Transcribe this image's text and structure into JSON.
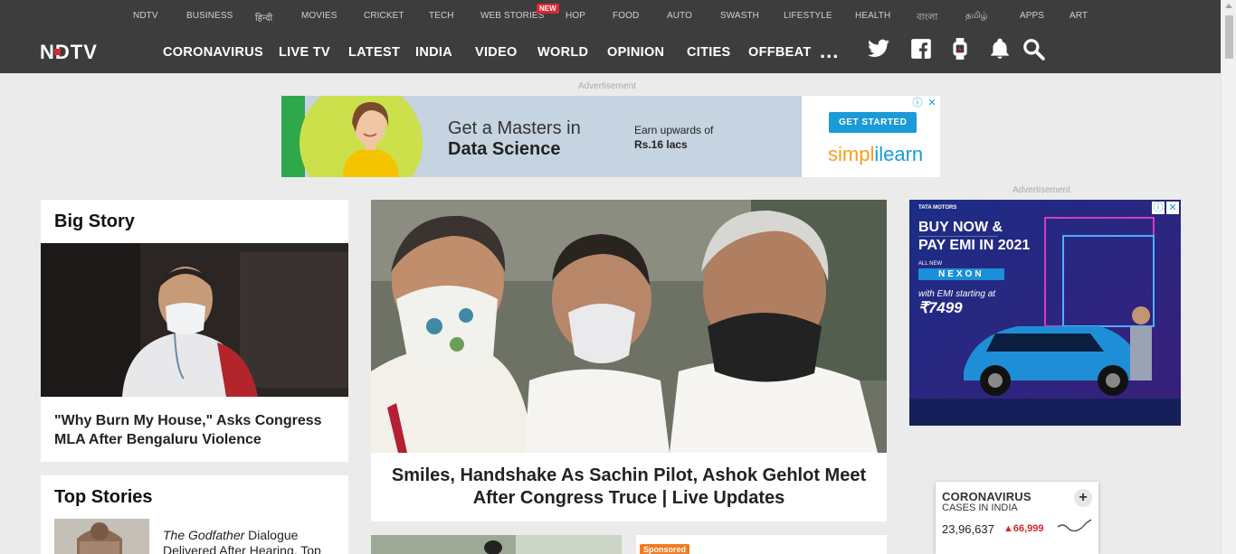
{
  "subnav": [
    "NDTV",
    "BUSINESS",
    "हिन्दी",
    "MOVIES",
    "CRICKET",
    "TECH",
    "WEB STORIES",
    "HOP",
    "FOOD",
    "AUTO",
    "SWASTH",
    "LIFESTYLE",
    "HEALTH",
    "বাংলা",
    "தமிழ்",
    "APPS",
    "ART"
  ],
  "subnav_badge": "NEW",
  "logo_text": "NDTV",
  "mainnav": [
    "CORONAVIRUS",
    "LIVE TV",
    "LATEST",
    "INDIA",
    "VIDEO",
    "WORLD",
    "OPINION",
    "CITIES",
    "OFFBEAT"
  ],
  "more": "...",
  "header_icons": [
    "twitter-icon",
    "facebook-icon",
    "smartwatch-icon",
    "bell-icon",
    "search-icon"
  ],
  "advertisement_label": "Advertisement",
  "top_ad": {
    "headline_1": "Get a Masters in",
    "headline_2": "Data Science",
    "earn_1": "Earn upwards of",
    "earn_2": "Rs.16 lacs",
    "cta": "GET STARTED",
    "brand_a": "simpl",
    "brand_b": "ilearn"
  },
  "big_story": {
    "title": "Big Story",
    "headline": "\"Why Burn My House,\" Asks Congress MLA After Bengaluru Violence"
  },
  "top_stories": {
    "title": "Top Stories",
    "item_italic": "The Godfather",
    "item_rest": " Dialogue Delivered After Hearing, Top"
  },
  "hero": {
    "headline": "Smiles, Handshake As Sachin Pilot, Ashok Gehlot Meet After Congress Truce | Live Updates"
  },
  "sponsored_label": "Sponsored",
  "side_ad": {
    "maker": "TATA MOTORS",
    "line1": "BUY NOW &",
    "line2": "PAY EMI IN 2021",
    "all_new": "ALL NEW",
    "model": "NEXON",
    "emi_text": "with EMI starting at",
    "price": "₹7499"
  },
  "corona": {
    "title": "CORONAVIRUS",
    "subtitle": "CASES IN INDIA",
    "cases": "23,96,637",
    "delta": "66,999"
  },
  "colors": {
    "header_bg": "#3d3d3d",
    "accent_red": "#e0262f",
    "page_bg": "#ebebeb"
  }
}
